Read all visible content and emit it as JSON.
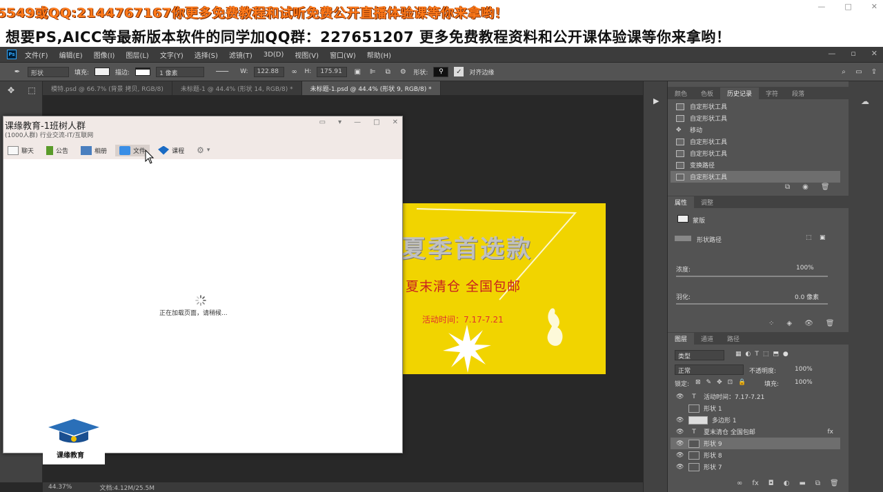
{
  "banners": {
    "top": "5549或QQ:2144767167你更多免费教程和试听免费公开直播体验课等你来拿哟！",
    "second": "想要PS,AICC等最新版本软件的同学加QQ群：227651207 更多免费教程资料和公开课体验课等你来拿哟！"
  },
  "menu": {
    "logo": "Ps",
    "items": [
      "文件(F)",
      "编辑(E)",
      "图像(I)",
      "图层(L)",
      "文字(Y)",
      "选择(S)",
      "滤镜(T)",
      "3D(D)",
      "视图(V)",
      "窗口(W)",
      "帮助(H)"
    ]
  },
  "options": {
    "mode": "形状",
    "fill_label": "填充:",
    "stroke_label": "描边:",
    "stroke_width": "1 像素",
    "w_label": "W:",
    "w_value": "122.88",
    "h_label": "H:",
    "h_value": "175.91",
    "shape_label": "形状:",
    "align_edges": "对齐边缘"
  },
  "tabs": [
    {
      "label": "模特.psd @ 66.7% (背景 拷贝, RGB/8)",
      "active": false
    },
    {
      "label": "未标题-1 @ 44.4% (形状 14, RGB/8) *",
      "active": false
    },
    {
      "label": "未标题-1.psd @ 44.4% (形状 9, RGB/8) *",
      "active": true
    }
  ],
  "poster": {
    "headline": "夏季首选款",
    "sub": "夏末清仓  全国包邮",
    "date": "活动时间：7.17-7.21",
    "bg_color": "#f1d400"
  },
  "qq": {
    "title": "课缘教育-1班树人群",
    "subtitle": "(1000人群) 行业交流-IT/互联网",
    "tabs": [
      {
        "label": "聊天",
        "icon": "chat-icon"
      },
      {
        "label": "公告",
        "icon": "notice-icon"
      },
      {
        "label": "相册",
        "icon": "album-icon"
      },
      {
        "label": "文件",
        "icon": "folder-icon"
      },
      {
        "label": "课程",
        "icon": "course-icon"
      }
    ],
    "loading": "正在加载页面，请稍候...",
    "brand": "课缘教育"
  },
  "status": {
    "zoom": "44.37%",
    "doc": "文档:4.12M/25.5M"
  },
  "history_panel": {
    "tabs": [
      "颜色",
      "色板",
      "历史记录",
      "字符",
      "段落"
    ],
    "active_tab": 2,
    "items": [
      {
        "label": "自定形状工具",
        "active": false
      },
      {
        "label": "自定形状工具",
        "active": false
      },
      {
        "label": "移动",
        "active": false
      },
      {
        "label": "自定形状工具",
        "active": false
      },
      {
        "label": "自定形状工具",
        "active": false
      },
      {
        "label": "变换路径",
        "active": false
      },
      {
        "label": "自定形状工具",
        "active": true
      }
    ]
  },
  "properties_panel": {
    "tabs": [
      "属性",
      "调整"
    ],
    "mask_label": "蒙版",
    "shape_path_label": "形状路径",
    "density_label": "浓度:",
    "density_value": "100%",
    "feather_label": "羽化:",
    "feather_value": "0.0 像素"
  },
  "layers_panel": {
    "tabs": [
      "图层",
      "通道",
      "路径"
    ],
    "filter_label": "类型",
    "blend_mode": "正常",
    "opacity_label": "不透明度:",
    "opacity_value": "100%",
    "lock_label": "锁定:",
    "fill_label": "填充:",
    "fill_value": "100%",
    "layers": [
      {
        "label": "活动时间：7.17-7.21",
        "kind": "text",
        "active": false
      },
      {
        "label": "形状 1",
        "kind": "shape",
        "active": false
      },
      {
        "label": "多边形 1",
        "kind": "polygon",
        "active": false
      },
      {
        "label": "夏末清仓  全国包邮",
        "kind": "text",
        "active": false
      },
      {
        "label": "形状 9",
        "kind": "shape",
        "active": true
      },
      {
        "label": "形状 8",
        "kind": "shape",
        "active": false
      },
      {
        "label": "形状 7",
        "kind": "shape",
        "active": false
      }
    ]
  }
}
